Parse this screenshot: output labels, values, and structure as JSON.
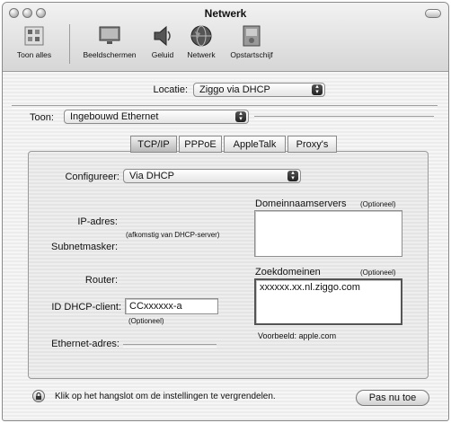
{
  "window": {
    "title": "Netwerk"
  },
  "toolbar": {
    "items": [
      {
        "label": "Toon alles",
        "icon": "grid-icon"
      },
      {
        "label": "Beeldschermen",
        "icon": "display-icon"
      },
      {
        "label": "Geluid",
        "icon": "speaker-icon"
      },
      {
        "label": "Netwerk",
        "icon": "globe-icon"
      },
      {
        "label": "Opstartschijf",
        "icon": "disk-icon"
      }
    ]
  },
  "location": {
    "label": "Locatie:",
    "value": "Ziggo via DHCP"
  },
  "show": {
    "label": "Toon:",
    "value": "Ingebouwd Ethernet"
  },
  "tabs": [
    "TCP/IP",
    "PPPoE",
    "AppleTalk",
    "Proxy's"
  ],
  "configure": {
    "label": "Configureer:",
    "value": "Via DHCP"
  },
  "ip": {
    "label": "IP-adres:",
    "note": "(afkomstig van DHCP-server)"
  },
  "subnet": {
    "label": "Subnetmasker:"
  },
  "router": {
    "label": "Router:"
  },
  "dhcp_client": {
    "label": "ID DHCP-client:",
    "value": "CCxxxxxx-a",
    "note": "(Optioneel)"
  },
  "ethernet": {
    "label": "Ethernet-adres:"
  },
  "dns": {
    "label": "Domeinnaamservers",
    "optional": "(Optioneel)",
    "value": ""
  },
  "search_domains": {
    "label": "Zoekdomeinen",
    "optional": "(Optioneel)",
    "value": "xxxxxx.xx.nl.ziggo.com",
    "example": "Voorbeeld: apple.com"
  },
  "lock": {
    "text": "Klik op het hangslot om de instellingen te vergrendelen.",
    "button": "Pas nu toe"
  }
}
